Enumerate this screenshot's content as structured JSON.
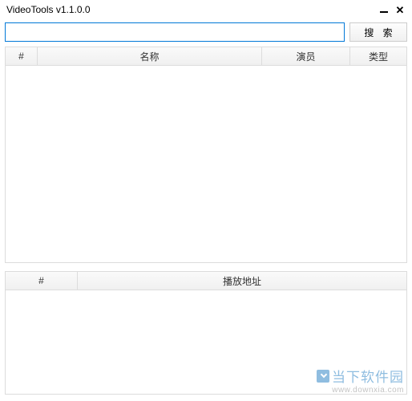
{
  "window": {
    "title": "VideoTools v1.1.0.0"
  },
  "search": {
    "value": "",
    "placeholder": "",
    "button_label": "搜 索"
  },
  "table1": {
    "headers": {
      "index": "#",
      "name": "名称",
      "actor": "演员",
      "type": "类型"
    },
    "rows": []
  },
  "table2": {
    "headers": {
      "index": "#",
      "play_url": "播放地址"
    },
    "rows": []
  },
  "watermark": {
    "text": "当下软件园",
    "url": "www.downxia.com"
  }
}
